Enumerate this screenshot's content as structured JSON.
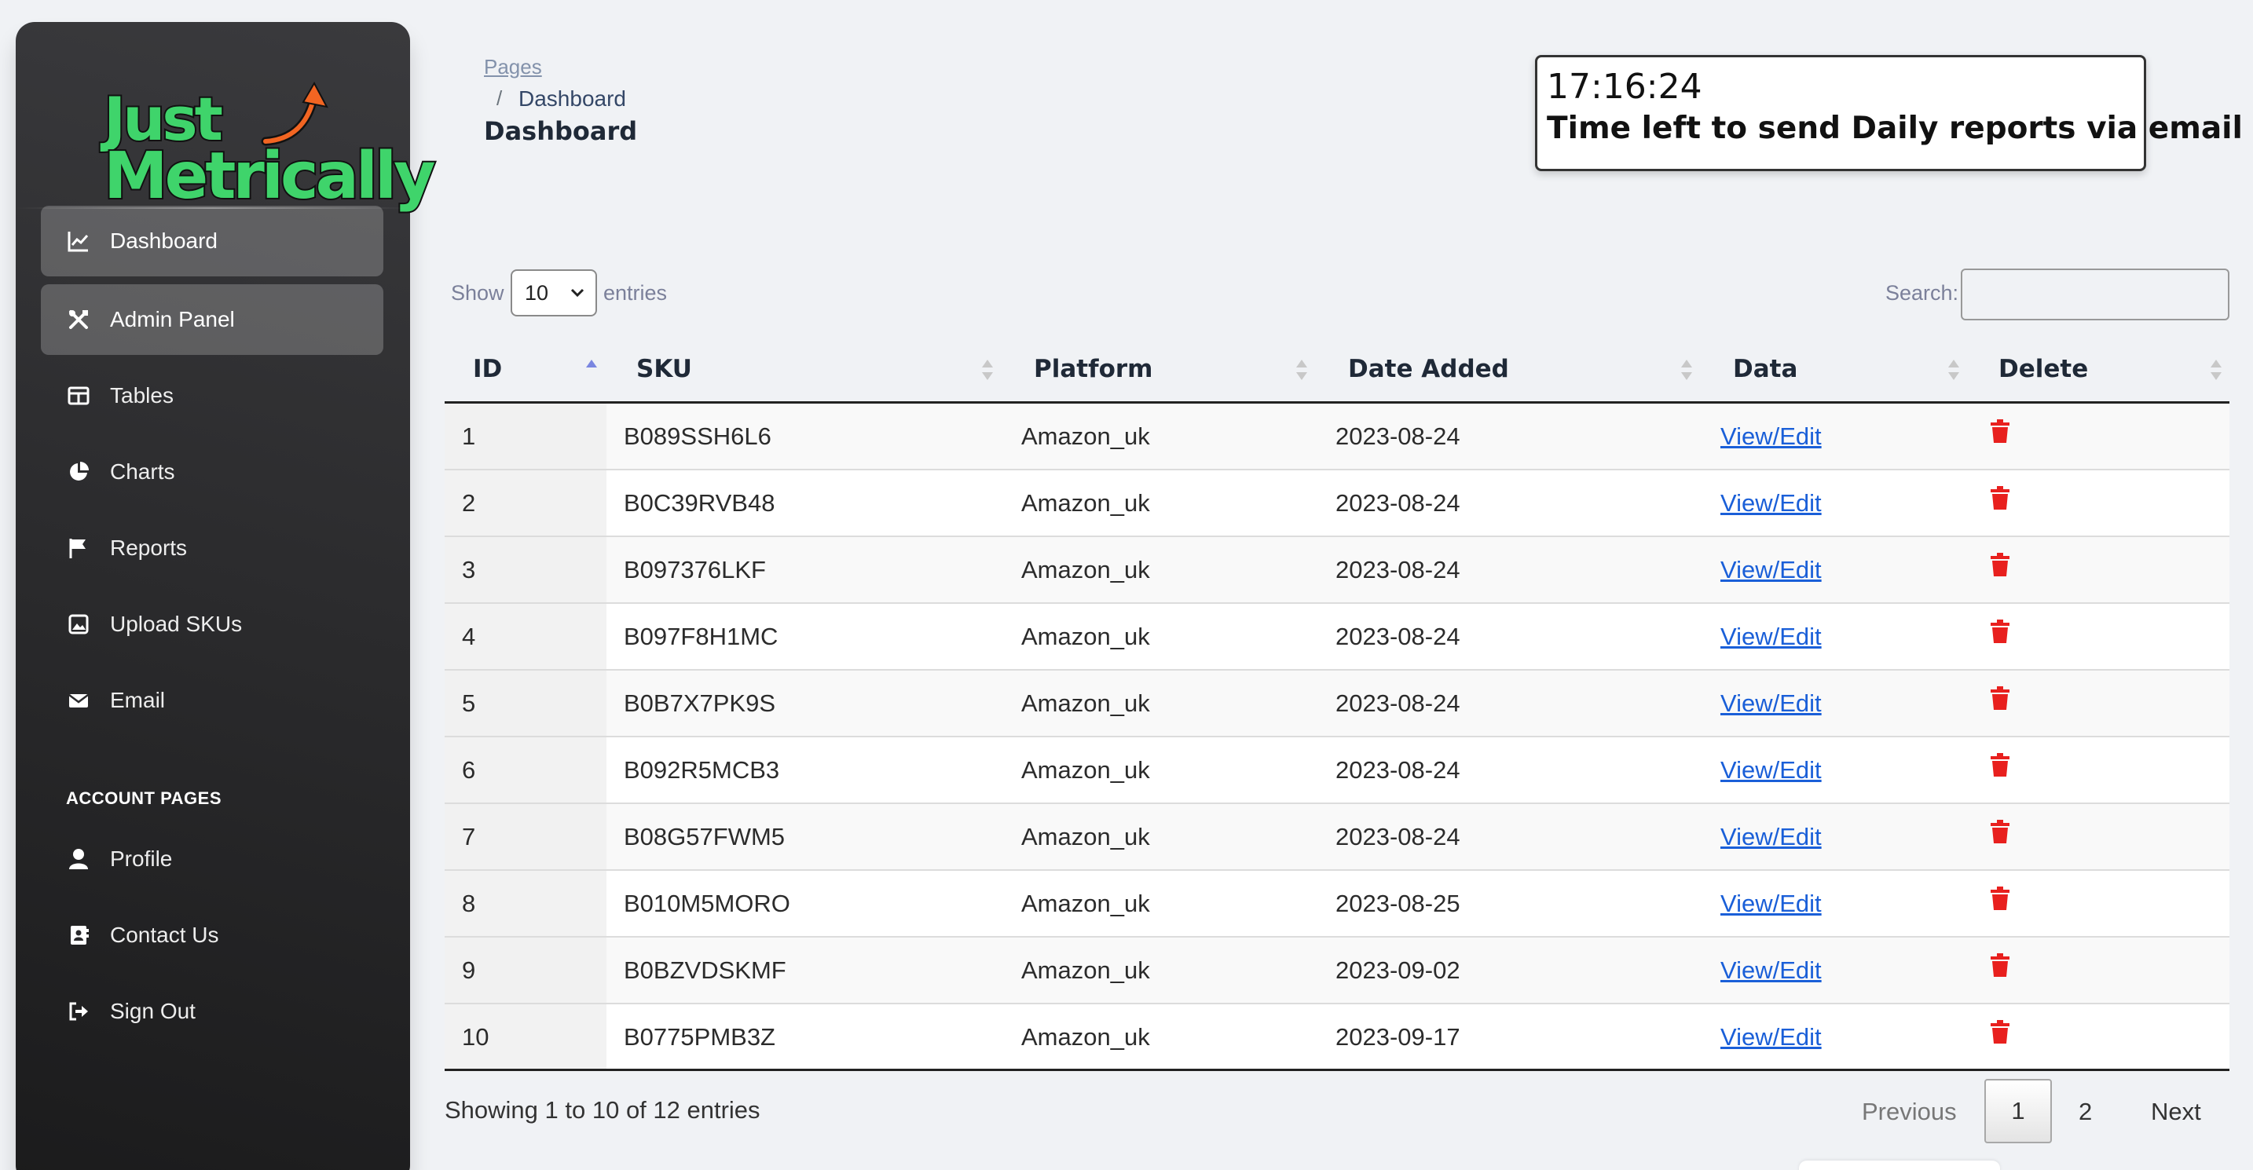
{
  "brand": {
    "line1": "Just",
    "line2": "Metrically"
  },
  "sidebar": {
    "items": [
      {
        "label": "Dashboard",
        "icon": "chart-line-icon",
        "active": true
      },
      {
        "label": "Admin Panel",
        "icon": "tools-icon",
        "active": true
      },
      {
        "label": "Tables",
        "icon": "table-icon",
        "active": false
      },
      {
        "label": "Charts",
        "icon": "pie-chart-icon",
        "active": false
      },
      {
        "label": "Reports",
        "icon": "flag-icon",
        "active": false
      },
      {
        "label": "Upload SKUs",
        "icon": "image-upload-icon",
        "active": false
      },
      {
        "label": "Email",
        "icon": "envelope-icon",
        "active": false
      }
    ],
    "account_section_title": "ACCOUNT PAGES",
    "account_items": [
      {
        "label": "Profile",
        "icon": "user-icon"
      },
      {
        "label": "Contact Us",
        "icon": "address-book-icon"
      },
      {
        "label": "Sign Out",
        "icon": "sign-out-icon"
      }
    ]
  },
  "breadcrumb": {
    "root": "Pages",
    "separator": "/",
    "current": "Dashboard"
  },
  "page_title": "Dashboard",
  "timer": {
    "time": "17:16:24",
    "message": "Time left to send Daily reports via email"
  },
  "table_controls": {
    "show_label": "Show",
    "entries_label": "entries",
    "page_length": "10",
    "search_label": "Search:",
    "search_value": ""
  },
  "table": {
    "columns": [
      "ID",
      "SKU",
      "Platform",
      "Date Added",
      "Data",
      "Delete"
    ],
    "sorted_column": "ID",
    "rows": [
      {
        "id": "1",
        "sku": "B089SSH6L6",
        "platform": "Amazon_uk",
        "date": "2023-08-24",
        "data": "View/Edit"
      },
      {
        "id": "2",
        "sku": "B0C39RVB48",
        "platform": "Amazon_uk",
        "date": "2023-08-24",
        "data": "View/Edit"
      },
      {
        "id": "3",
        "sku": "B097376LKF",
        "platform": "Amazon_uk",
        "date": "2023-08-24",
        "data": "View/Edit"
      },
      {
        "id": "4",
        "sku": "B097F8H1MC",
        "platform": "Amazon_uk",
        "date": "2023-08-24",
        "data": "View/Edit"
      },
      {
        "id": "5",
        "sku": "B0B7X7PK9S",
        "platform": "Amazon_uk",
        "date": "2023-08-24",
        "data": "View/Edit"
      },
      {
        "id": "6",
        "sku": "B092R5MCB3",
        "platform": "Amazon_uk",
        "date": "2023-08-24",
        "data": "View/Edit"
      },
      {
        "id": "7",
        "sku": "B08G57FWM5",
        "platform": "Amazon_uk",
        "date": "2023-08-24",
        "data": "View/Edit"
      },
      {
        "id": "8",
        "sku": "B010M5MORO",
        "platform": "Amazon_uk",
        "date": "2023-08-25",
        "data": "View/Edit"
      },
      {
        "id": "9",
        "sku": "B0BZVDSKMF",
        "platform": "Amazon_uk",
        "date": "2023-09-02",
        "data": "View/Edit"
      },
      {
        "id": "10",
        "sku": "B0775PMB3Z",
        "platform": "Amazon_uk",
        "date": "2023-09-17",
        "data": "View/Edit"
      }
    ],
    "delete_icon": "trash-icon"
  },
  "footer": {
    "info": "Showing 1 to 10 of 12 entries",
    "previous": "Previous",
    "pages": [
      "1",
      "2"
    ],
    "current_page": "1",
    "next": "Next"
  },
  "colors": {
    "sidebar_bg": "#2a2a2c",
    "brand_green": "#3fd46b",
    "brand_arrow": "#f26522",
    "link": "#1a5fd8",
    "delete": "#e8201e",
    "page_bg": "#f0f2f5"
  }
}
